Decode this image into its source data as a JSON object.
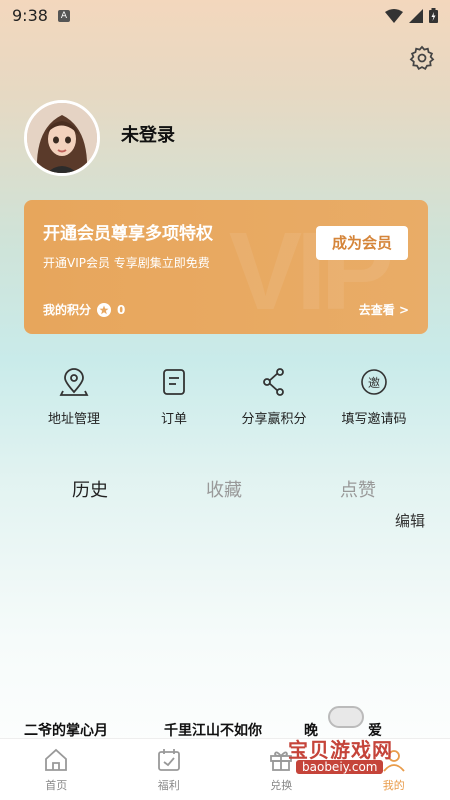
{
  "status_bar": {
    "time": "9:38",
    "notif_letter": "A"
  },
  "profile": {
    "username": "未登录"
  },
  "vip": {
    "title": "开通会员尊享多项特权",
    "subtitle": "开通VIP会员 专享剧集立即免费",
    "button": "成为会员",
    "points_label": "我的积分",
    "points_value": "0",
    "more": "去查看 >",
    "watermark": "VIP"
  },
  "quick_actions": [
    {
      "label": "地址管理",
      "icon": "location-pin-icon"
    },
    {
      "label": "订单",
      "icon": "order-list-icon"
    },
    {
      "label": "分享赢积分",
      "icon": "share-icon"
    },
    {
      "label": "填写邀请码",
      "icon": "invite-code-icon"
    }
  ],
  "invite_icon_char": "邀",
  "tabs": [
    "历史",
    "收藏",
    "点赞"
  ],
  "edit_label": "编辑",
  "recent_titles": [
    "二爷的掌心月",
    "千里江山不如你",
    "晚",
    "爱"
  ],
  "bottom_nav": [
    {
      "label": "首页",
      "icon": "home-icon"
    },
    {
      "label": "福利",
      "icon": "calendar-check-icon"
    },
    {
      "label": "兑换",
      "icon": "gift-icon"
    },
    {
      "label": "我的",
      "icon": "profile-icon"
    }
  ],
  "site_watermark": {
    "text": "宝贝游戏网",
    "url": "baobeiy.com"
  },
  "colors": {
    "accent": "#e99c4b",
    "vip_card": "#e8a862",
    "vip_button_text": "#d5853a"
  }
}
